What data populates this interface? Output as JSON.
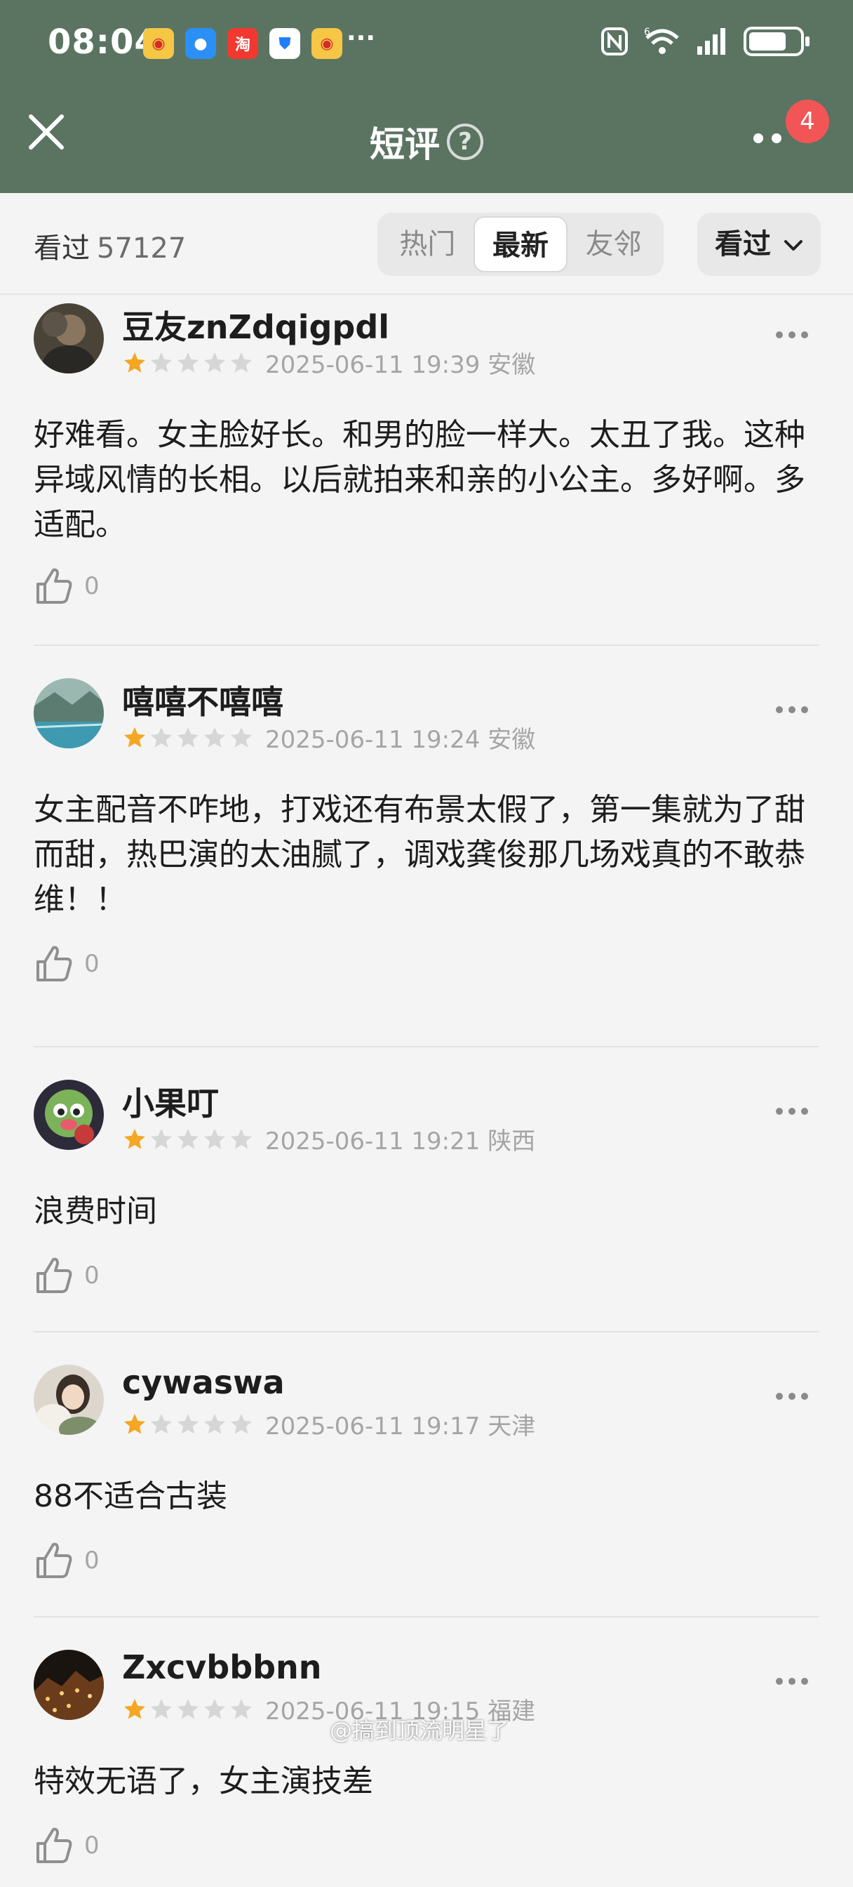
{
  "status_bar": {
    "time": "08:04",
    "app_icons": [
      "weibo-icon",
      "message-icon",
      "taobao-icon",
      "shield-icon",
      "weibo-icon"
    ],
    "overflow": "···",
    "network": "6",
    "battery_level": 0.65
  },
  "navbar": {
    "title": "短评",
    "help": "?",
    "notification_count": "4"
  },
  "filter": {
    "label": "看过",
    "count": "57127",
    "tabs": [
      "热门",
      "最新",
      "友邻"
    ],
    "active_tab": "最新",
    "dropdown": "看过"
  },
  "comments": [
    {
      "username": "豆友znZdqigpdl",
      "rating": 1,
      "max_rating": 5,
      "meta": "2025-06-11 19:39 安徽",
      "text": "好难看。女主脸好长。和男的脸一样大。太丑了我。这种异域风情的长相。以后就拍来和亲的小公主。多好啊。多适配。",
      "likes": "0"
    },
    {
      "username": "嘻嘻不嘻嘻",
      "rating": 1,
      "max_rating": 5,
      "meta": "2025-06-11 19:24 安徽",
      "text": "女主配音不咋地，打戏还有布景太假了，第一集就为了甜而甜，热巴演的太油腻了，调戏龚俊那几场戏真的不敢恭维！！",
      "likes": "0"
    },
    {
      "username": "小果叮",
      "rating": 1,
      "max_rating": 5,
      "meta": "2025-06-11 19:21 陕西",
      "text": "浪费时间",
      "likes": "0"
    },
    {
      "username": "cywaswa",
      "rating": 1,
      "max_rating": 5,
      "meta": "2025-06-11 19:17 天津",
      "text": "88不适合古装",
      "likes": "0"
    },
    {
      "username": "Zxcvbbbnn",
      "rating": 1,
      "max_rating": 5,
      "meta": "2025-06-11 19:15 福建",
      "text": "特效无语了，女主演技差",
      "likes": "0"
    }
  ],
  "watermark": "@搞到顶流明星了",
  "colors": {
    "header_bg": "#5b7462",
    "page_bg": "#f3f4f3",
    "star_on": "#f5a623",
    "star_off": "#d6d6d6",
    "badge": "#f25555"
  }
}
